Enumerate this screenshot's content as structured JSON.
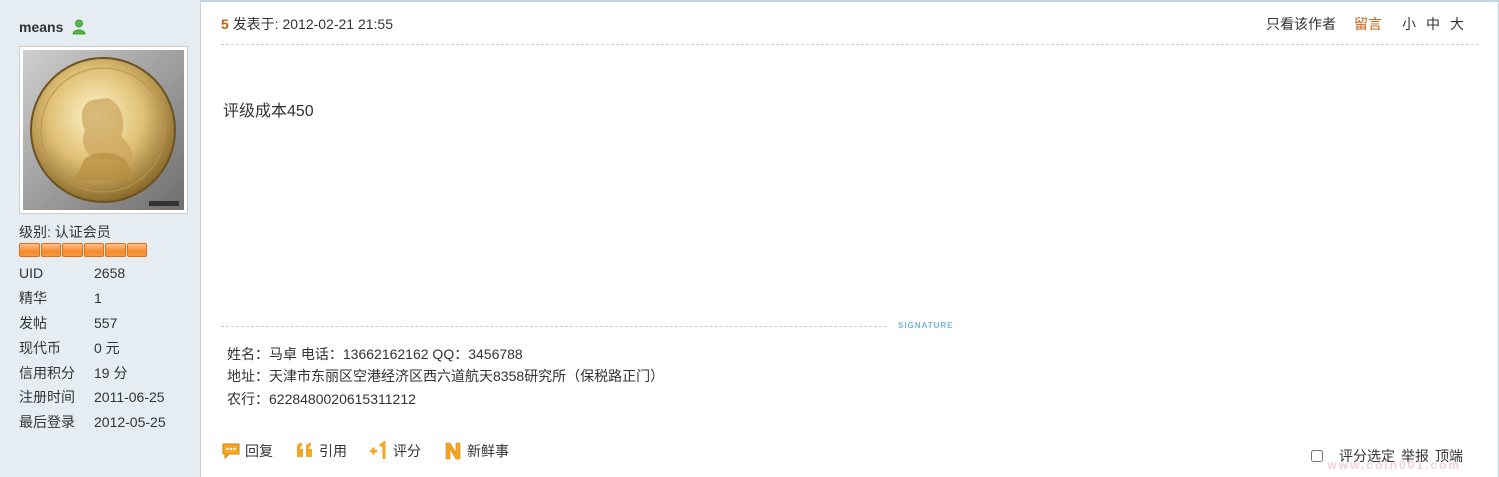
{
  "user": {
    "name": "means",
    "online_icon": "user-online-icon",
    "level_label": "级别: 认证会员",
    "level_segments": 6,
    "stats": [
      {
        "label": "UID",
        "value": "2658"
      },
      {
        "label": "精华",
        "value": "1"
      },
      {
        "label": "发帖",
        "value": "557"
      },
      {
        "label": "现代币",
        "value": "0 元"
      },
      {
        "label": "信用积分",
        "value": "19 分"
      },
      {
        "label": "注册时间",
        "value": "2011-06-25"
      },
      {
        "label": "最后登录",
        "value": "2012-05-25"
      }
    ]
  },
  "post": {
    "floor": "5",
    "posted_at": "发表于: 2012-02-21 21:55",
    "only_author": "只看该作者",
    "leave_message": "留言",
    "font_small": "小",
    "font_medium": "中",
    "font_large": "大",
    "body": "评级成本450",
    "signature_tag": "SIGNATURE",
    "signature_lines": [
      "姓名：马卓  电话：13662162162  QQ：3456788",
      "地址：天津市东丽区空港经济区西六道航天8358研究所（保税路正门）",
      "农行：6228480020615311212"
    ]
  },
  "footer": {
    "reply": "回复",
    "quote": "引用",
    "rate": "评分",
    "fresh": "新鲜事",
    "rate_select": "评分选定",
    "report": "举报",
    "top": "顶端"
  },
  "watermark": "www.coin001.com",
  "colors": {
    "sidebar_bg": "#e5edf2",
    "accent_orange": "#c65e0b",
    "border_blue": "#c2d5e3",
    "signature_blue": "#6fb7e4"
  }
}
